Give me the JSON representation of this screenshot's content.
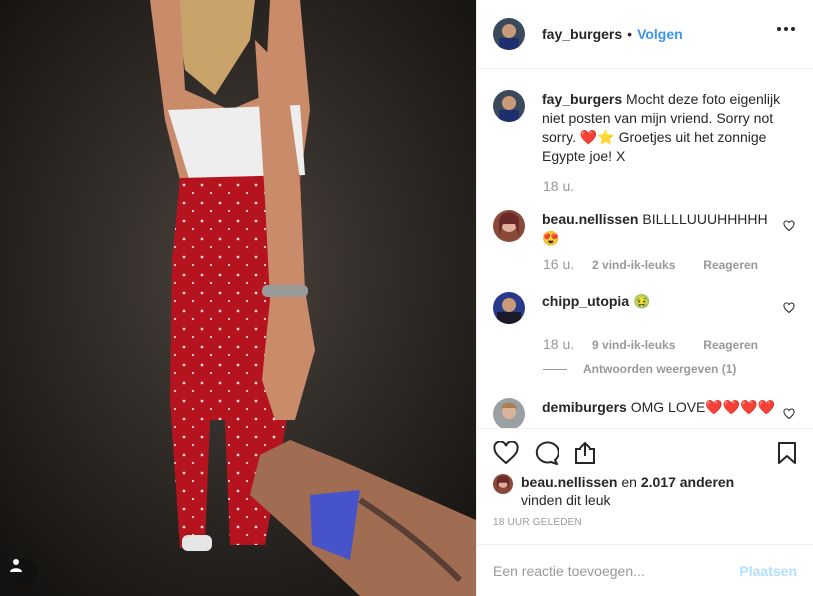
{
  "post": {
    "author": "fay_burgers",
    "follow_label": "Volgen",
    "separator": "•",
    "caption_text": "Mocht deze foto eigenlijk niet posten van mijn vriend. Sorry not sorry. ❤️⭐ Groetjes uit het zonnige Egypte joe! X",
    "caption_age": "18 u."
  },
  "comments": [
    {
      "user": "beau.nellissen",
      "text": "BILLLLUUUHHHHH 😍",
      "age": "16 u.",
      "likes": "2 vind-ik-leuks",
      "reply_label": "Reageren"
    },
    {
      "user": "chipp_utopia",
      "text": "🤢",
      "age": "18 u.",
      "likes": "9 vind-ik-leuks",
      "reply_label": "Reageren",
      "view_replies": "Antwoorden weergeven (1)"
    },
    {
      "user": "demiburgers",
      "text": "OMG LOVE❤️❤️❤️❤️"
    }
  ],
  "likes_summary": {
    "user": "beau.nellissen",
    "connector": " en ",
    "others": "2.017 anderen",
    "suffix": "vinden dit leuk"
  },
  "timestamp": "18 UUR GELEDEN",
  "add_comment": {
    "placeholder": "Een reactie toevoegen...",
    "post_label": "Plaatsen"
  },
  "colors": {
    "link": "#3897f0",
    "muted": "#999999",
    "post_disabled": "#b2dffc"
  },
  "icons": [
    "more-options-icon",
    "heart-icon",
    "comment-icon",
    "share-icon",
    "bookmark-icon",
    "user-tag-icon"
  ]
}
